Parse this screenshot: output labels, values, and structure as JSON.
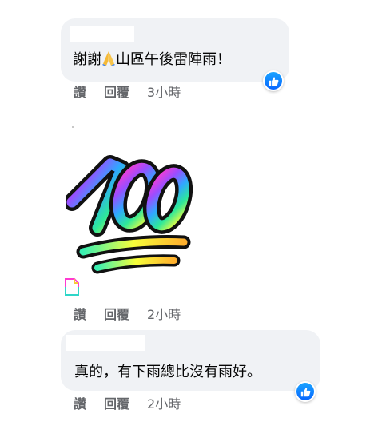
{
  "comments": [
    {
      "text_before": "謝謝",
      "text_after": "山區午後雷陣雨！",
      "emoji": "folded-hands-emoji",
      "reaction": "like",
      "actions": {
        "like": "讚",
        "reply": "回覆",
        "time": "3小時"
      }
    },
    {
      "sticker": "hundred-points-sticker",
      "actions": {
        "like": "讚",
        "reply": "回覆",
        "time": "2小時"
      }
    },
    {
      "text": "真的，有下雨總比沒有雨好。",
      "reaction": "like",
      "actions": {
        "like": "讚",
        "reply": "回覆",
        "time": "2小時"
      }
    }
  ],
  "colors": {
    "bubble": "#f0f2f5",
    "text": "#050505",
    "meta": "#65676b",
    "like_blue": "#0866ff"
  }
}
